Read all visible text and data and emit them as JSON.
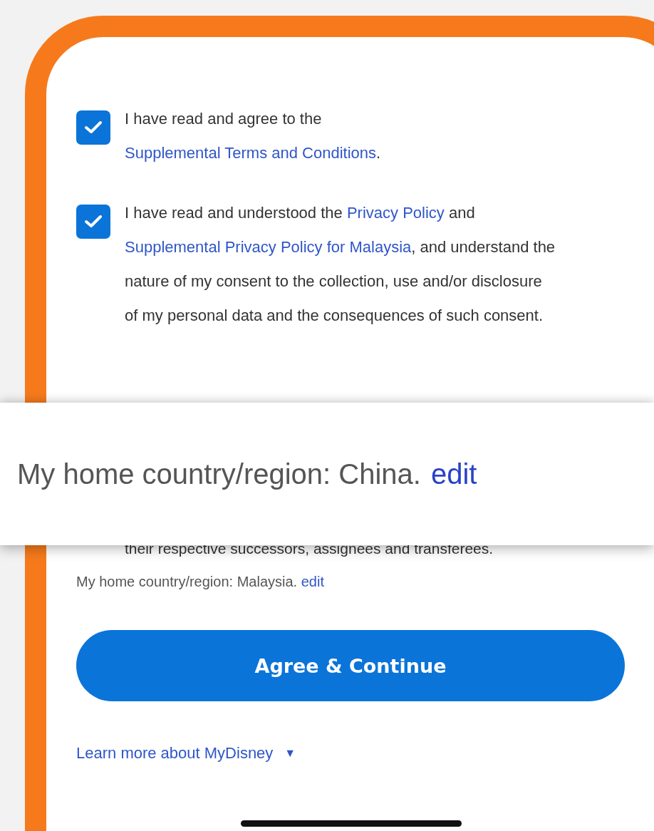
{
  "consents": [
    {
      "checked": true,
      "parts": [
        {
          "text": "I have read and agree to the ",
          "link": false
        },
        {
          "text": "Supplemental Terms and Conditions",
          "link": true
        },
        {
          "text": ".",
          "link": false
        }
      ]
    },
    {
      "checked": true,
      "parts": [
        {
          "text": "I have read and understood the ",
          "link": false
        },
        {
          "text": "Privacy Policy",
          "link": true
        },
        {
          "text": " and ",
          "link": false
        },
        {
          "text": "Supplemental Privacy Policy for Malaysia",
          "link": true
        },
        {
          "text": ", and understand the nature of my consent to the collection, use and/or disclosure of my personal data and the consequences of such consent.",
          "link": false
        }
      ]
    }
  ],
  "hidden_text_tail": "their respective successors, assignees and transferees.",
  "home_region": {
    "label": "My home country/region: Malaysia.",
    "link": "edit"
  },
  "primary_button": "Agree & Continue",
  "learn_more": {
    "label": "Learn more about MyDisney",
    "icon": "▼"
  },
  "callout": {
    "label": "My home country/region: China.",
    "link": "edit"
  }
}
